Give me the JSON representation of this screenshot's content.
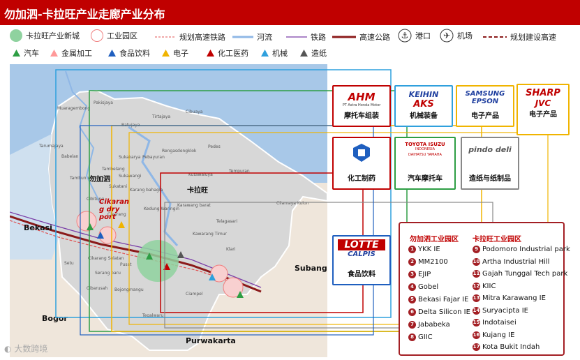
{
  "title": "勿加泗-卡拉旺产业走廊产业分布",
  "legend": {
    "row1": [
      {
        "icon": "green-circle",
        "label": "卡拉旺产业新城"
      },
      {
        "icon": "pink-circle",
        "label": "工业园区"
      },
      {
        "icon": "planned-rail-line",
        "label": "规划高速铁路"
      },
      {
        "icon": "river-line",
        "label": "河流"
      },
      {
        "icon": "rail-line",
        "label": "铁路"
      },
      {
        "icon": "highway-line",
        "label": "高速公路"
      },
      {
        "icon": "anchor-icon",
        "label": "港口"
      },
      {
        "icon": "airplane-icon",
        "label": "机场"
      },
      {
        "icon": "planned-highway-line",
        "label": "规划建设高速"
      }
    ],
    "row2": [
      {
        "color": "#2e9e44",
        "label": "汽车"
      },
      {
        "color": "#ff9999",
        "label": "金属加工"
      },
      {
        "color": "#1f5fbf",
        "label": "食品饮料"
      },
      {
        "color": "#f0b400",
        "label": "电子"
      },
      {
        "color": "#c00000",
        "label": "化工医药"
      },
      {
        "color": "#2fa0dd",
        "label": "机械"
      },
      {
        "color": "#555555",
        "label": "造纸"
      }
    ]
  },
  "map": {
    "regions": {
      "bekasi": "Bekasi",
      "bogor": "Bogor",
      "subang": "Subang",
      "purwakarta": "Purwakarta"
    },
    "bekasi_cn": "勿加泗",
    "karawang_cn": "卡拉旺",
    "cikarang_dry_port": [
      "Cikaran",
      "g dry",
      "port"
    ],
    "places": [
      "Muaragembong",
      "Pakisjaya",
      "Tirtajaya",
      "Cibuaya",
      "Tarumajaya",
      "Babelan",
      "Batujaya",
      "Sukakarya",
      "Pebayuran",
      "Rengasdengklok",
      "Pedes",
      "Tambelang",
      "Sukawangi",
      "Tambun utara",
      "Karang bahagia",
      "Kutawaluya",
      "Tempuran",
      "Sukatani",
      "Cibitung",
      "Cikarang",
      "Kedung Waringin",
      "Karawang barat",
      "Cilamaya Kulon",
      "Kawarang Timur",
      "Telagasari",
      "Setu",
      "Cikarang Selatan",
      "Pusat",
      "Klari",
      "Cibarusah",
      "Serang baru",
      "Bojongmangu",
      "Ciampel",
      "Tegalwaru",
      "Sukaresmi",
      "Majalaya"
    ]
  },
  "industries": [
    {
      "brands": [
        "AHM",
        "PT Astra Honda Motor"
      ],
      "label": "摩托车组装"
    },
    {
      "brands": [
        "KEIHIN",
        "AKS"
      ],
      "label": "机械装备"
    },
    {
      "brands": [
        "SAMSUNG",
        "EPSON"
      ],
      "label": "电子产品"
    },
    {
      "brands": [
        "SHARP",
        "JVC"
      ],
      "label": "电子产品"
    },
    {
      "brands": [],
      "label": "化工制药"
    },
    {
      "brands": [
        "TOYOTA",
        "INDONESIA",
        "ISUZU",
        "DAIHATSU",
        "YAMAHA"
      ],
      "label": "汽车摩托车"
    },
    {
      "brands": [
        "pindo deli"
      ],
      "label": "造纸与纸制品"
    },
    {
      "brands": [
        "LOTTE",
        "CALPIS"
      ],
      "label": "食品饮料"
    }
  ],
  "parks": {
    "bekasi_title": "勿加泗工业园区",
    "karawang_title": "卡拉旺工业园区",
    "bekasi": [
      {
        "n": "1",
        "name": "YKK IE"
      },
      {
        "n": "2",
        "name": "MM2100"
      },
      {
        "n": "3",
        "name": "EJIP"
      },
      {
        "n": "4",
        "name": "Gobel"
      },
      {
        "n": "5",
        "name": "Bekasi Fajar IE"
      },
      {
        "n": "6",
        "name": "Delta Silicon IE"
      },
      {
        "n": "7",
        "name": "Jababeka"
      },
      {
        "n": "8",
        "name": "GIIC"
      }
    ],
    "karawang": [
      {
        "n": "9",
        "name": "Podomoro Industrial park"
      },
      {
        "n": "10",
        "name": "Artha Industrial Hill"
      },
      {
        "n": "11",
        "name": "Gajah Tunggal Tech park"
      },
      {
        "n": "12",
        "name": "KIIC"
      },
      {
        "n": "13",
        "name": "Mitra Karawang IE"
      },
      {
        "n": "14",
        "name": "Suryacipta IE"
      },
      {
        "n": "15",
        "name": "Indotaisei"
      },
      {
        "n": "16",
        "name": "Kujang IE"
      },
      {
        "n": "17",
        "name": "Kota Bukit Indah"
      }
    ]
  },
  "watermark": "大数跨境"
}
